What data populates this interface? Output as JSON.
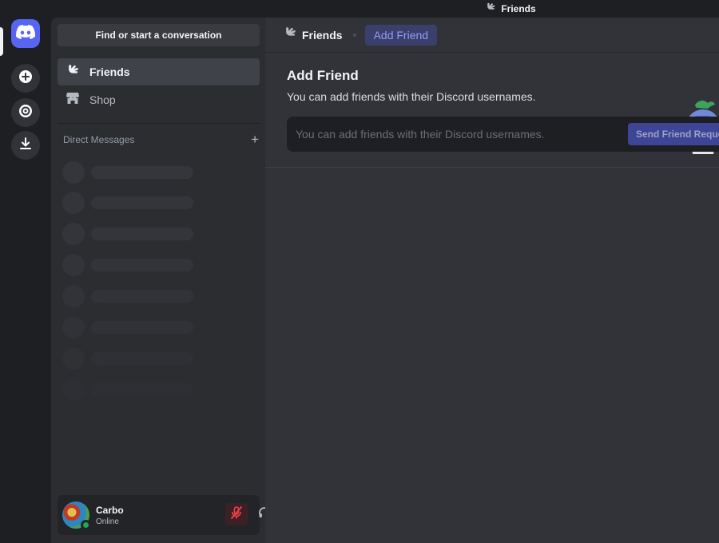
{
  "titlebar": {
    "title": "Friends"
  },
  "rail": {
    "home_icon": "discord-logo-icon",
    "add_icon": "plus-circle-icon",
    "explore_icon": "compass-icon",
    "download_icon": "download-icon"
  },
  "sidebar": {
    "search_label": "Find or start a conversation",
    "nav": [
      {
        "label": "Friends",
        "icon": "friends-wave-icon",
        "active": true
      },
      {
        "label": "Shop",
        "icon": "shop-icon",
        "active": false
      }
    ],
    "dm_header": "Direct Messages",
    "dm_add": "+"
  },
  "user": {
    "name": "Carbo",
    "status": "Online",
    "status_color": "#23a55a"
  },
  "header": {
    "title": "Friends",
    "active_tab": "Add Friend"
  },
  "add_friend": {
    "title": "Add Friend",
    "subtitle": "You can add friends with their Discord usernames.",
    "input_placeholder": "You can add friends with their Discord usernames.",
    "button_label": "Send Friend Request"
  },
  "colors": {
    "brand": "#5865f2",
    "background": "#313338",
    "sidebar": "#2b2d31",
    "rail": "#1e1f22"
  }
}
